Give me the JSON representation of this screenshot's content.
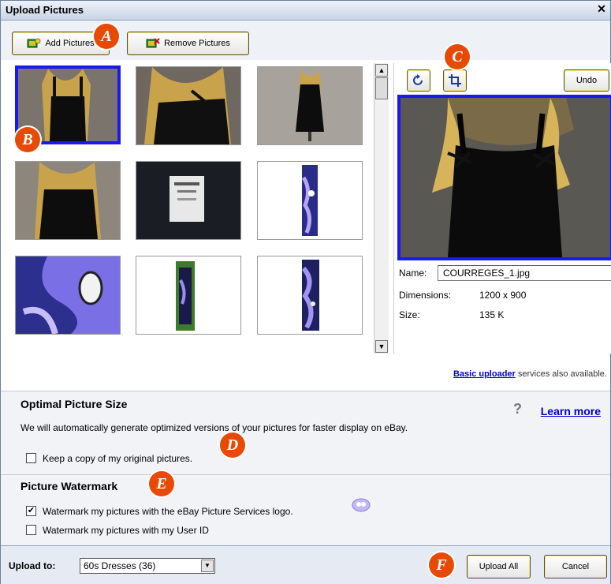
{
  "window": {
    "title": "Upload Pictures",
    "close_glyph": "✕"
  },
  "toolbar": {
    "add_label": "Add Pictures",
    "remove_label": "Remove Pictures"
  },
  "badges": {
    "a": "A",
    "b": "B",
    "c": "C",
    "d": "D",
    "e": "E",
    "f": "F"
  },
  "preview_pane": {
    "rotate_icon": "rotate-icon",
    "crop_icon": "crop-icon",
    "undo_label": "Undo",
    "name_label": "Name:",
    "name_value": "COURREGES_1.jpg",
    "dimensions_label": "Dimensions:",
    "dimensions_value": "1200 x 900",
    "size_label": "Size:",
    "size_value": "135 K"
  },
  "thumbnails": {
    "count": 9,
    "selected_index": 0
  },
  "basic_uploader": {
    "link": "Basic uploader",
    "text": "services also available."
  },
  "optimal": {
    "heading": "Optimal Picture Size",
    "description": "We will automatically generate optimized versions of your pictures for faster display on eBay.",
    "checkbox_label": "Keep a copy of my original pictures.",
    "checked": false,
    "learn_more": "Learn more"
  },
  "watermark": {
    "heading": "Picture Watermark",
    "option1_label": "Watermark my pictures with the eBay Picture Services logo.",
    "option1_checked": true,
    "option2_label": "Watermark my pictures with my User ID",
    "option2_checked": false
  },
  "footer": {
    "upload_to_label": "Upload to:",
    "upload_to_value": "60s Dresses (36)",
    "upload_all_label": "Upload All",
    "cancel_label": "Cancel"
  }
}
